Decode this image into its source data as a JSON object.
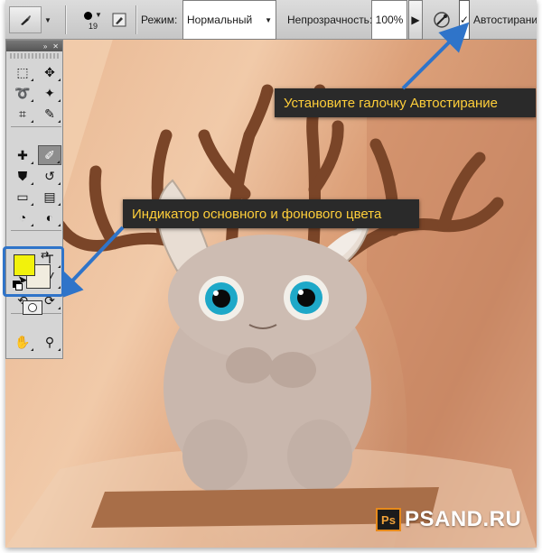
{
  "options_bar": {
    "brush_size": "19",
    "mode_label": "Режим:",
    "mode_value": "Нормальный",
    "opacity_label": "Непрозрачность:",
    "opacity_value": "100%",
    "auto_erase_label": "Автостирание",
    "auto_erase_checked": "✓"
  },
  "tools_panel": {
    "tools": [
      "marquee-icon",
      "move-icon",
      "lasso-icon",
      "magic-wand-icon",
      "crop-icon",
      "eyedropper-icon",
      "healing-brush-icon",
      "brush-icon",
      "clone-stamp-icon",
      "history-brush-icon",
      "eraser-icon",
      "gradient-icon",
      "blur-icon",
      "dodge-icon",
      "pen-icon",
      "type-icon",
      "path-selection-icon",
      "line-icon",
      "3d-rotate-icon",
      "3d-orbit-icon",
      "hand-icon",
      "zoom-icon"
    ],
    "active_tool": "brush-icon",
    "foreground_color": "#f2f20c",
    "background_color": "#f1ecdf"
  },
  "callouts": {
    "auto_erase_hint": "Установите галочку Автостирание",
    "colors_hint": "Индикатор основного и фонового цвета"
  },
  "watermark": {
    "logo": "Ps",
    "text": "PSAND.RU"
  },
  "colors": {
    "callout_bg": "#2a2a2a",
    "callout_text": "#ffcf3a",
    "highlight_blue": "#2f74c9"
  }
}
